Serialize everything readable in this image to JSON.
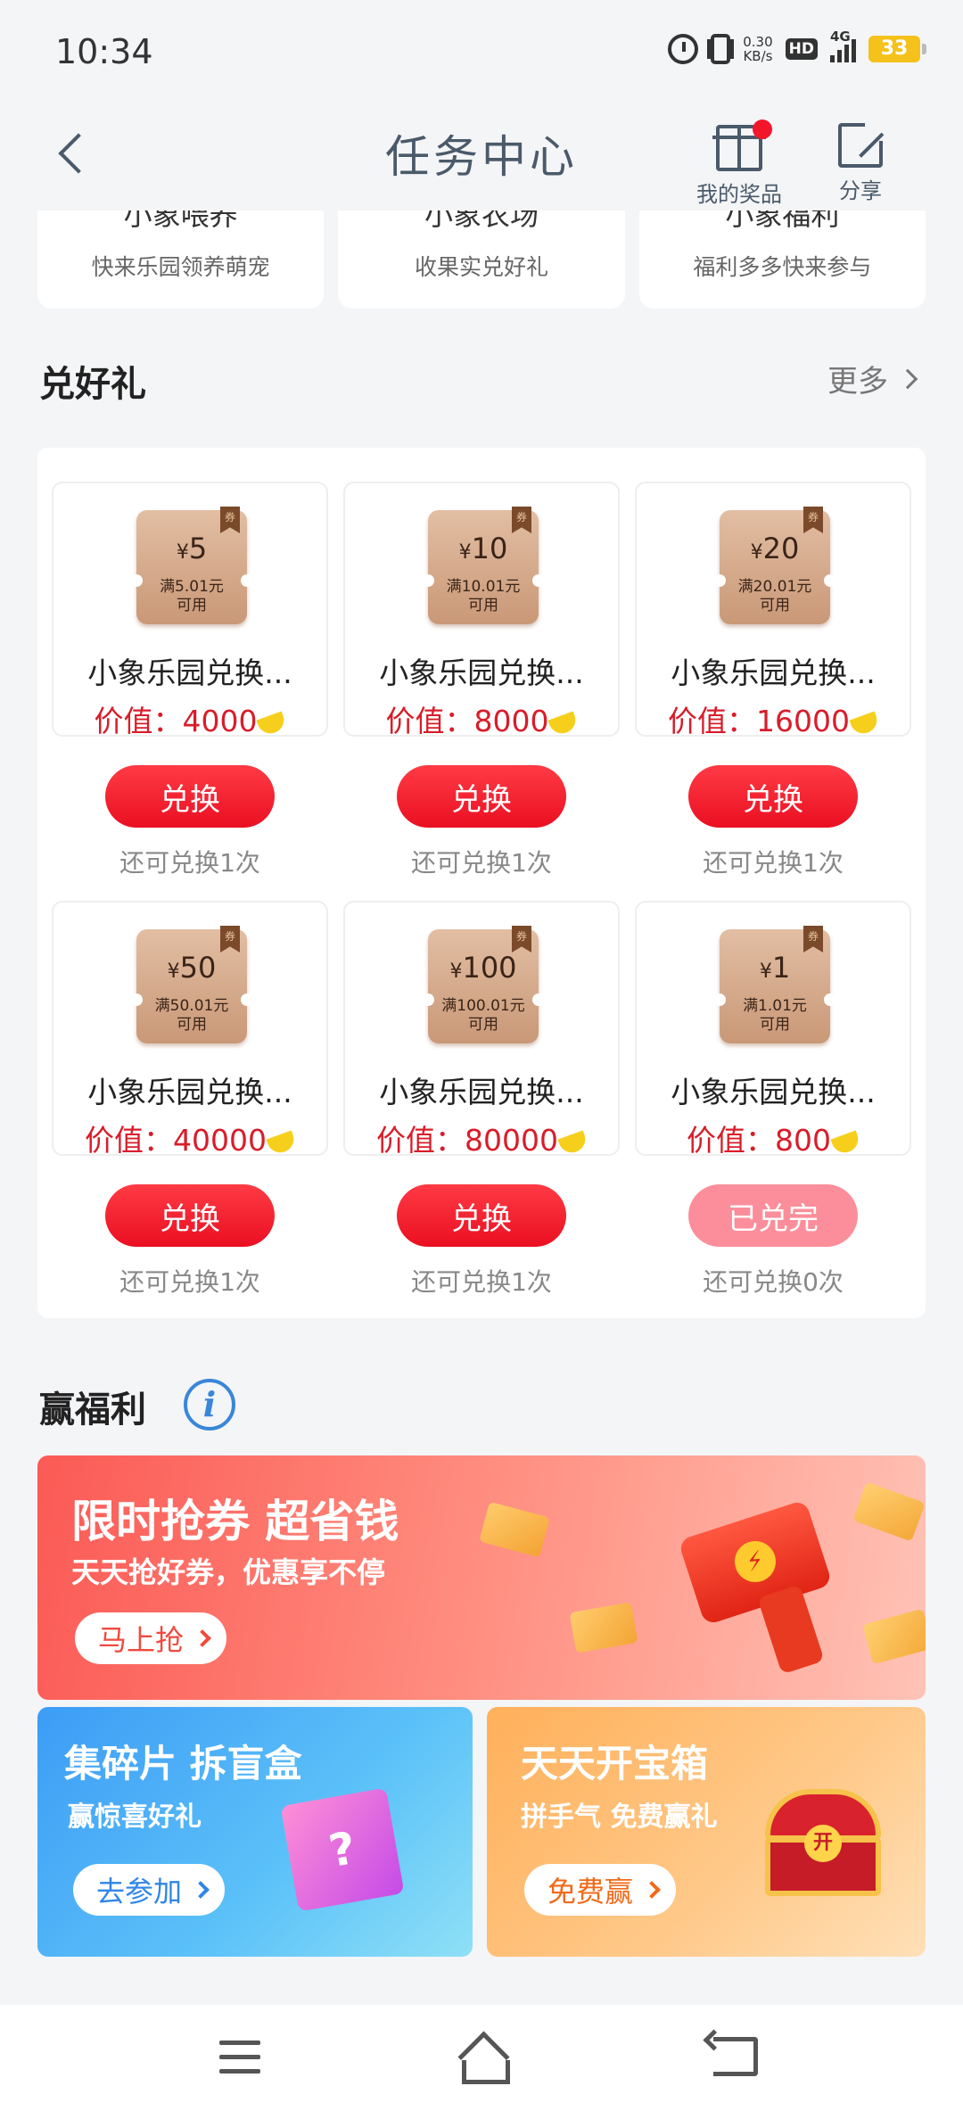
{
  "status_bar": {
    "time": "10:34",
    "net_speed_value": "0.30",
    "net_speed_unit": "KB/s",
    "hd": "HD",
    "network": "4G",
    "battery": "33"
  },
  "header": {
    "title": "任务中心",
    "prizes_label": "我的奖品",
    "share_label": "分享"
  },
  "top_cards": [
    {
      "name": "小象喂养",
      "desc": "快来乐园领养萌宠"
    },
    {
      "name": "小象农场",
      "desc": "收果实兑好礼"
    },
    {
      "name": "小象福利",
      "desc": "福利多多快来参与"
    }
  ],
  "redeem_section": {
    "title": "兑好礼",
    "more": "更多",
    "value_prefix": "价值：",
    "coupon_tag": "券",
    "coupon_usable": "可用",
    "items": [
      {
        "amount": "5",
        "condition": "满5.01元",
        "name": "小象乐园兑换...",
        "value": "4000",
        "button": "兑换",
        "remaining": "还可兑换1次",
        "available": true
      },
      {
        "amount": "10",
        "condition": "满10.01元",
        "name": "小象乐园兑换...",
        "value": "8000",
        "button": "兑换",
        "remaining": "还可兑换1次",
        "available": true
      },
      {
        "amount": "20",
        "condition": "满20.01元",
        "name": "小象乐园兑换...",
        "value": "16000",
        "button": "兑换",
        "remaining": "还可兑换1次",
        "available": true
      },
      {
        "amount": "50",
        "condition": "满50.01元",
        "name": "小象乐园兑换...",
        "value": "40000",
        "button": "兑换",
        "remaining": "还可兑换1次",
        "available": true
      },
      {
        "amount": "100",
        "condition": "满100.01元",
        "name": "小象乐园兑换...",
        "value": "80000",
        "button": "兑换",
        "remaining": "还可兑换1次",
        "available": true
      },
      {
        "amount": "1",
        "condition": "满1.01元",
        "name": "小象乐园兑换...",
        "value": "800",
        "button": "已兑完",
        "remaining": "还可兑换0次",
        "available": false
      }
    ]
  },
  "welfare_section": {
    "title": "赢福利",
    "info_icon": "i",
    "banners": {
      "coupon": {
        "title": "限时抢券 超省钱",
        "subtitle": "天天抢好券，优惠享不停",
        "button": "马上抢",
        "icon": "⚡"
      },
      "blindbox": {
        "title": "集碎片 拆盲盒",
        "subtitle": "赢惊喜好礼",
        "button": "去参加",
        "icon": "?"
      },
      "treasure": {
        "title": "天天开宝箱",
        "subtitle": "拼手气 免费赢礼",
        "button": "免费赢",
        "icon": "开"
      }
    }
  },
  "colors": {
    "accent_red": "#ea0f22",
    "disabled_red": "#fb8e9a",
    "value_red": "#d81d2a",
    "info_blue": "#3a86d8"
  }
}
